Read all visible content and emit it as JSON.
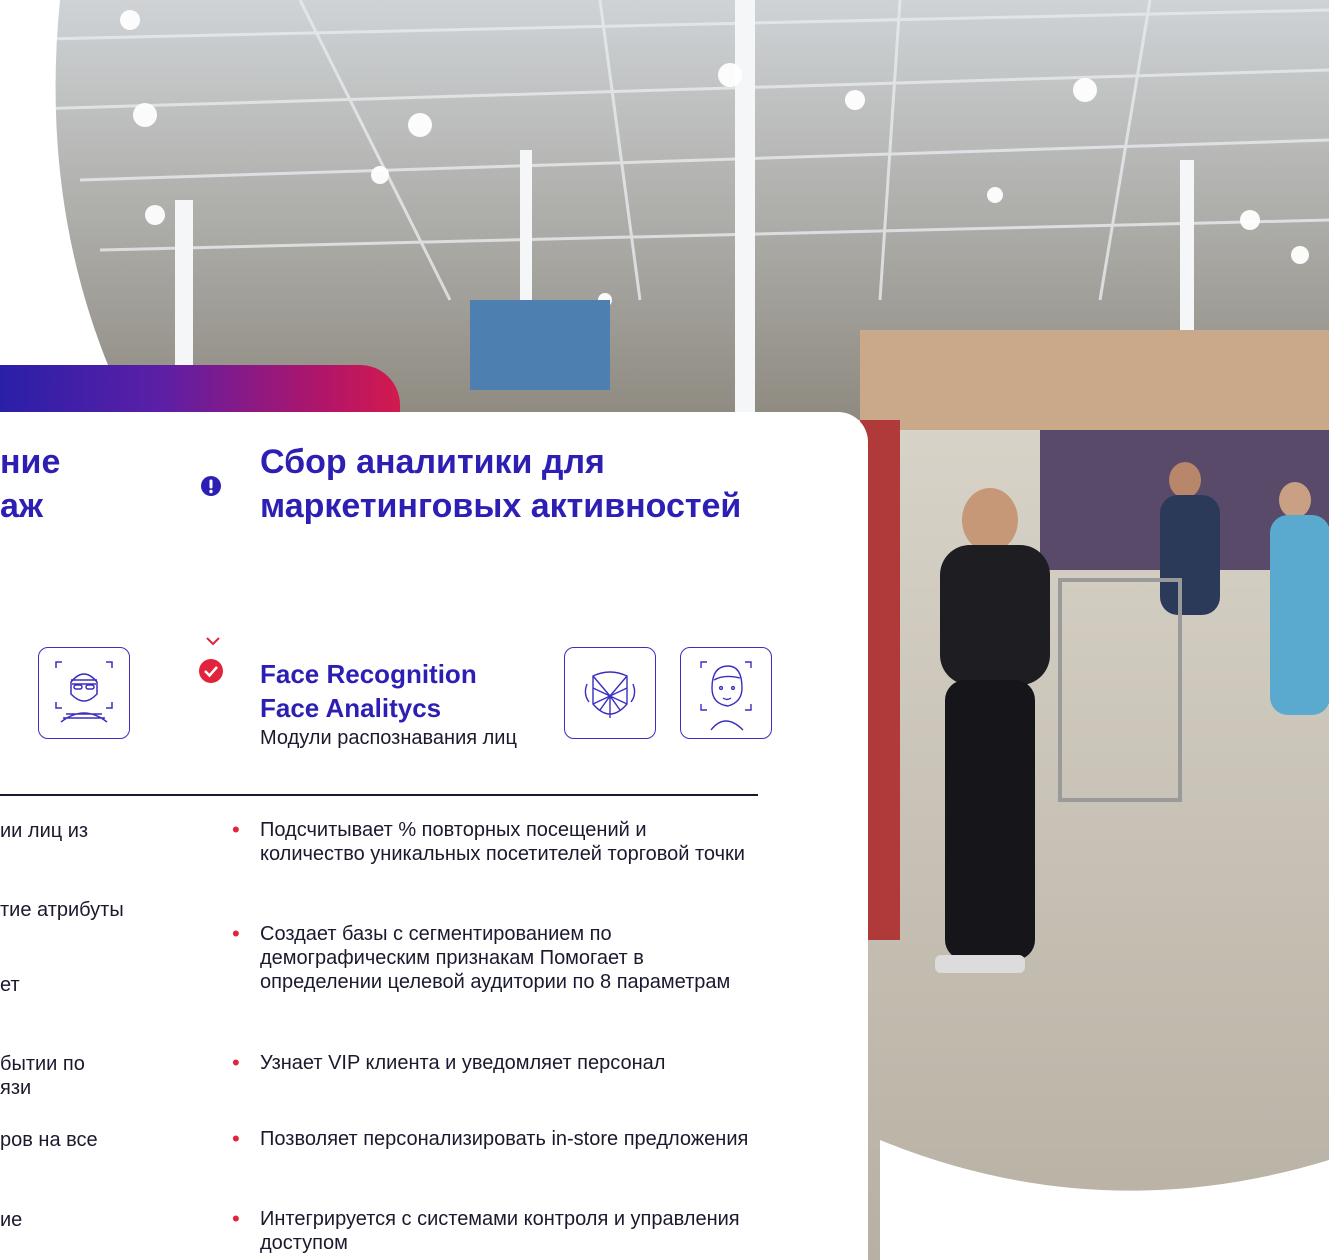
{
  "left_title": {
    "line1": "ние",
    "line2": "аж"
  },
  "right_title": "Сбор аналитики для маркетинговых активностей",
  "module": {
    "title_line1": "Face Recognition",
    "title_line2": "Face Analitycs",
    "subtitle": "Модули распознавания лиц"
  },
  "left_bullets": [
    "ии лиц из",
    "тие атрибуты",
    "ет",
    "бытии по",
    "язи",
    "ров на все",
    "ие"
  ],
  "right_bullets": [
    "Подсчитывает % повторных посещений и количество уникальных посетителей торговой точки",
    "Создает базы с сегментированием по демографическим признакам Помогает в определении целевой аудитории по 8 параметрам",
    "Узнает VIP клиента и уведомляет персонал",
    "Позволяет персонализировать in-store предложения",
    "Интегрируется с системами контроля и управления доступом"
  ],
  "colors": {
    "title": "#2d1fb3",
    "bullet_dot": "#e2233d",
    "icon_border": "#3a2fc0"
  },
  "icons": [
    "alert-icon",
    "check-icon",
    "masked-face-icon",
    "face-scan-mesh-icon",
    "face-portrait-icon"
  ]
}
